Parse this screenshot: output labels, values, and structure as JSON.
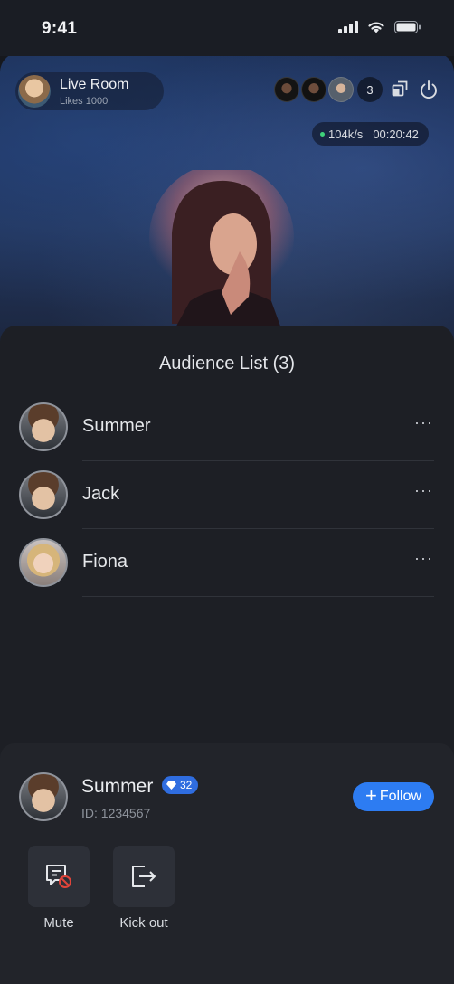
{
  "status_bar": {
    "time": "9:41"
  },
  "room": {
    "title": "Live Room",
    "likes": "Likes 1000"
  },
  "viewers": {
    "count": "3"
  },
  "stream_stats": {
    "bitrate": "104k/s",
    "duration": "00:20:42"
  },
  "audience": {
    "title": "Audience List (3)",
    "members": [
      {
        "name": "Summer",
        "more": "···"
      },
      {
        "name": "Jack",
        "more": "···"
      },
      {
        "name": "Fiona",
        "more": "···"
      }
    ]
  },
  "user_card": {
    "name": "Summer",
    "level": "32",
    "id_text": "ID: 1234567",
    "follow_label": "Follow",
    "actions": {
      "mute": "Mute",
      "kick_out": "Kick out"
    }
  },
  "colors": {
    "accent": "#2d7cf2",
    "live_dot": "#3fd27a",
    "mute_badge": "#e0443a"
  }
}
